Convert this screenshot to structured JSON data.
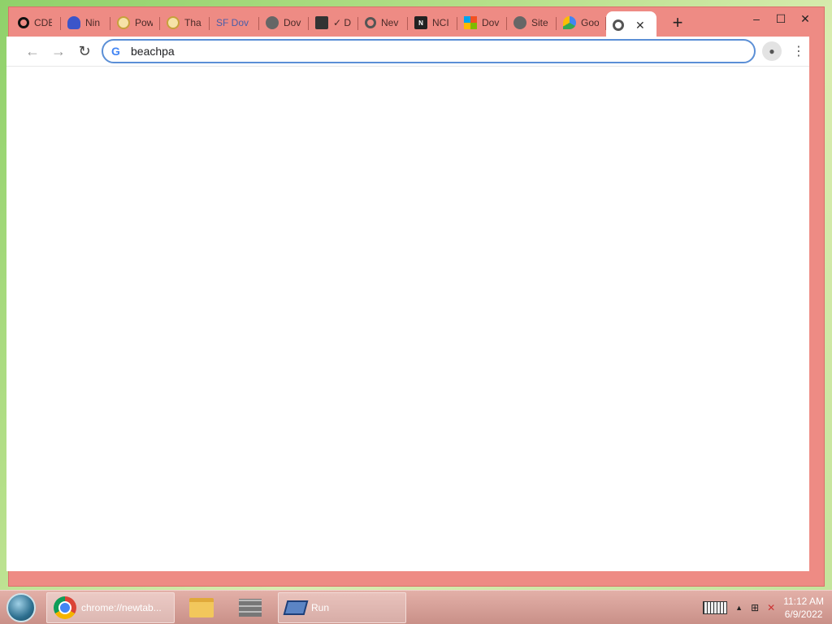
{
  "browser": {
    "tabs": [
      {
        "label": "CDB",
        "icon": "opera-icon"
      },
      {
        "label": "Nin",
        "icon": "ninja-icon"
      },
      {
        "label": "Pow",
        "icon": "power-icon"
      },
      {
        "label": "Tha",
        "icon": "power-icon"
      },
      {
        "label": "SF Dov",
        "icon": "sf-icon"
      },
      {
        "label": "Dov",
        "icon": "globe-icon"
      },
      {
        "label": "✓ D",
        "icon": "app-icon"
      },
      {
        "label": "Nev",
        "icon": "chrome-icon"
      },
      {
        "label": "NCI",
        "icon": "nci-icon"
      },
      {
        "label": "Dov",
        "icon": "windows-icon"
      },
      {
        "label": "Site",
        "icon": "globe-icon"
      },
      {
        "label": "Goo",
        "icon": "maps-icon"
      },
      {
        "label": "",
        "icon": "chrome-icon",
        "active": true
      }
    ],
    "omnibox": {
      "value": "beachpa"
    },
    "window_controls": {
      "minimize": "–",
      "maximize": "☐",
      "close": "✕"
    }
  },
  "taskbar": {
    "items": [
      {
        "label": "chrome://newtab..."
      },
      {
        "label": ""
      },
      {
        "label": ""
      },
      {
        "label": "Run"
      }
    ],
    "clock": {
      "time": "11:12 AM",
      "date": "6/9/2022"
    }
  },
  "colors": {
    "frame": "#ee8b84",
    "omnibox_border": "#5b8fd6"
  }
}
